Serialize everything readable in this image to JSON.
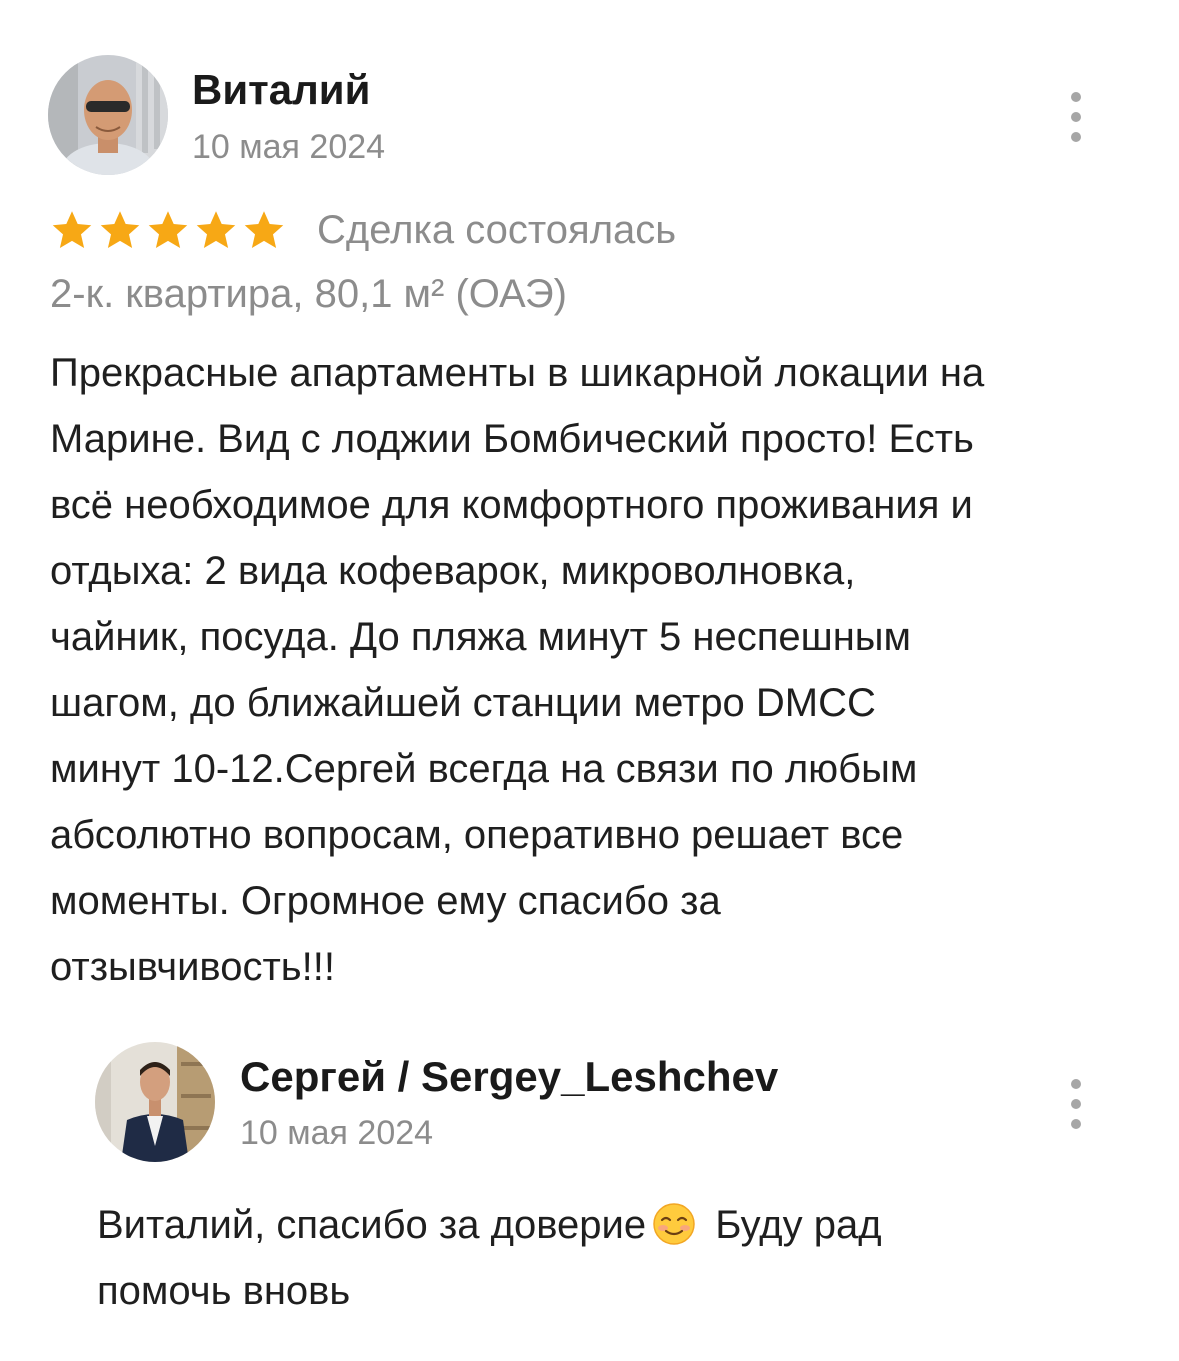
{
  "review": {
    "author": "Виталий",
    "date": "10 мая 2024",
    "rating": 5,
    "rating_max": 5,
    "status": "Сделка состоялась",
    "property": "2-к. квартира, 80,1 м² (ОАЭ)",
    "text_lines": [
      "Прекрасные апартаменты в шикарной локации на",
      "Марине. Вид с лоджии Бомбический просто! Есть",
      "всё необходимое для комфортного проживания и",
      "отдыха: 2 вида кофеварок, микроволновка,",
      "чайник, посуда. До пляжа  минут 5 неспешным",
      "шагом, до ближайшей станции метро DMCC",
      "минут 10-12.Сергей всегда на связи по любым",
      "абсолютно вопросам, оперативно решает все",
      "моменты. Огромное ему спасибо за",
      "отзывчивость!!!"
    ]
  },
  "reply": {
    "author": "Сергей / Sergey_Leshchev",
    "date": "10 мая 2024",
    "text_line1_before_emoji": "Виталий, спасибо за доверие",
    "emoji": "smiling-face-icon",
    "text_line1_after_emoji": "Буду рад",
    "text_line2": "помочь вновь"
  },
  "colors": {
    "star": "#F7A815",
    "secondary_text": "#8C8C8C",
    "primary_text": "#1F1F1F",
    "menu_dots": "#A6A6A6"
  }
}
